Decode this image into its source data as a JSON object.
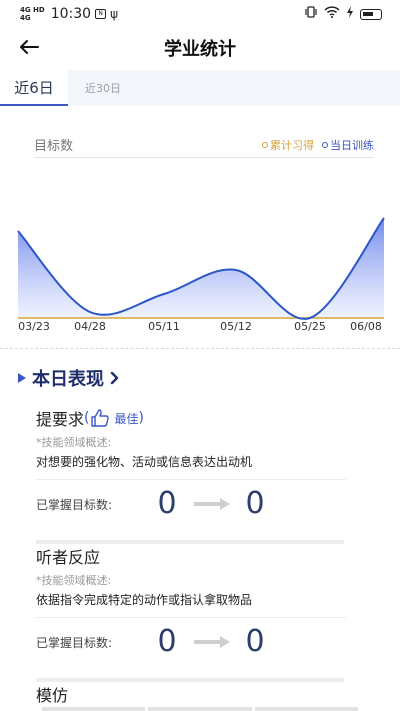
{
  "status_bar": {
    "network_top": "4G HD",
    "network_bottom": "4G",
    "time": "10:30",
    "battery_icon": "battery-icon",
    "wifi_icon": "wifi-icon"
  },
  "nav": {
    "title": "学业统计",
    "back_icon": "back-arrow-icon"
  },
  "tabs": [
    {
      "label": "近6日",
      "active": true
    },
    {
      "label": "近30日",
      "active": false
    }
  ],
  "chart_data": {
    "type": "area",
    "ylabel": "目标数",
    "legend": [
      {
        "name": "累计习得",
        "color": "#d8a33a"
      },
      {
        "name": "当日训练",
        "color": "#3a56c8"
      }
    ],
    "legend_position": "top-right",
    "categories": [
      "03/23",
      "04/28",
      "05/11",
      "05/12",
      "05/25",
      "06/08"
    ],
    "series": [
      {
        "name": "累计习得",
        "color": "#d8a33a",
        "values": [
          0,
          0,
          0,
          0,
          0,
          0
        ]
      },
      {
        "name": "当日训练",
        "color": "#2a56c8",
        "values": [
          0.87,
          0.06,
          0.24,
          0.48,
          0.0,
          1.0
        ]
      }
    ],
    "grid": false
  },
  "today": {
    "title": "本日表现",
    "skills": [
      {
        "name": "提要求",
        "rating": "最佳",
        "sub_label": "*技能领域概述:",
        "description": "对想要的强化物、活动或信息表达出动机",
        "mastery_label": "已掌握目标数:",
        "from": "0",
        "to": "0"
      },
      {
        "name": "听者反应",
        "sub_label": "*技能领域概述:",
        "description": "依据指令完成特定的动作或指认拿取物品",
        "mastery_label": "已掌握目标数:",
        "from": "0",
        "to": "0"
      },
      {
        "name": "模仿"
      }
    ]
  },
  "colors": {
    "accent": "#3a56c8",
    "title_dark": "#1e2e6a",
    "gold": "#d8a33a"
  }
}
